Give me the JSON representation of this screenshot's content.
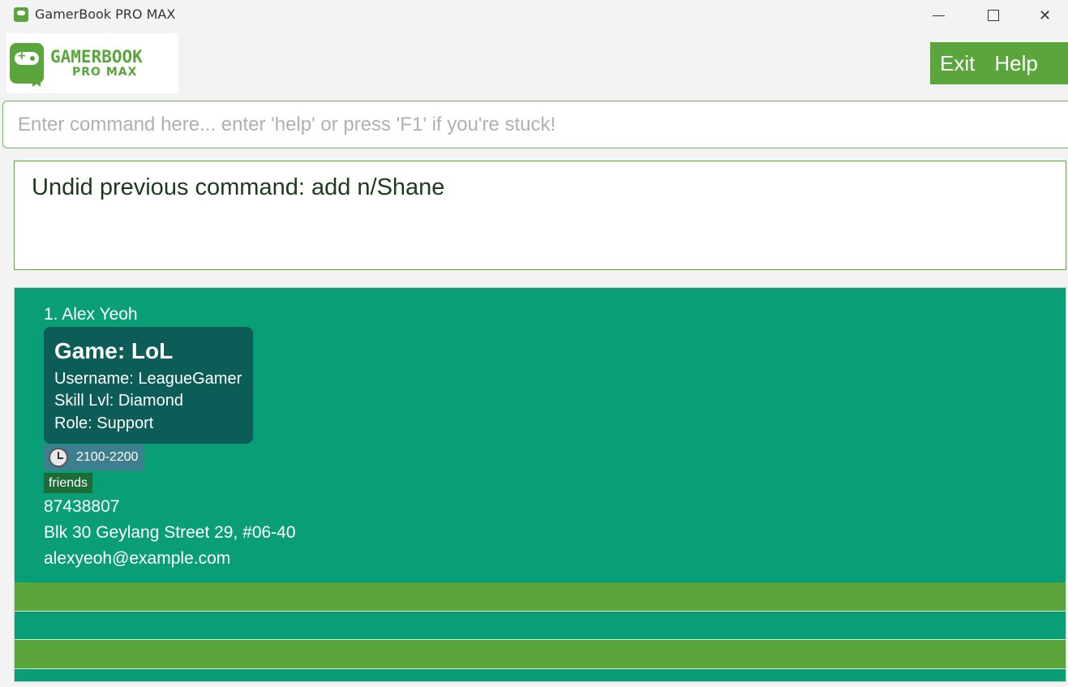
{
  "window": {
    "title": "GamerBook PRO MAX",
    "minimize_icon": "minimize-icon",
    "maximize_icon": "maximize-icon",
    "close_label": "✕"
  },
  "logo": {
    "line1": "GAMERBOOK",
    "line2": "PRO MAX"
  },
  "menu": {
    "exit_label": "Exit",
    "help_label": "Help"
  },
  "command": {
    "value": "",
    "placeholder": "Enter command here... enter 'help' or press 'F1' if you're stuck!"
  },
  "result": {
    "message": "Undid previous command: add n/Shane"
  },
  "colors": {
    "accent_green": "#5aa63d",
    "list_teal": "#0a9e76",
    "game_box": "#0c5c57",
    "time_tag": "#3d7f8e",
    "friends_tag": "#1d6b36"
  },
  "persons": [
    {
      "index_name": "1. Alex Yeoh",
      "game": {
        "title": "Game: LoL",
        "username": "Username: LeagueGamer",
        "skill": "Skill Lvl: Diamond",
        "role": "Role: Support"
      },
      "time_icon": "clock-icon",
      "time_range": "2100-2200",
      "tag": "friends",
      "phone": "87438807",
      "address": "Blk 30 Geylang Street 29, #06-40",
      "email": "alexyeoh@example.com"
    }
  ]
}
